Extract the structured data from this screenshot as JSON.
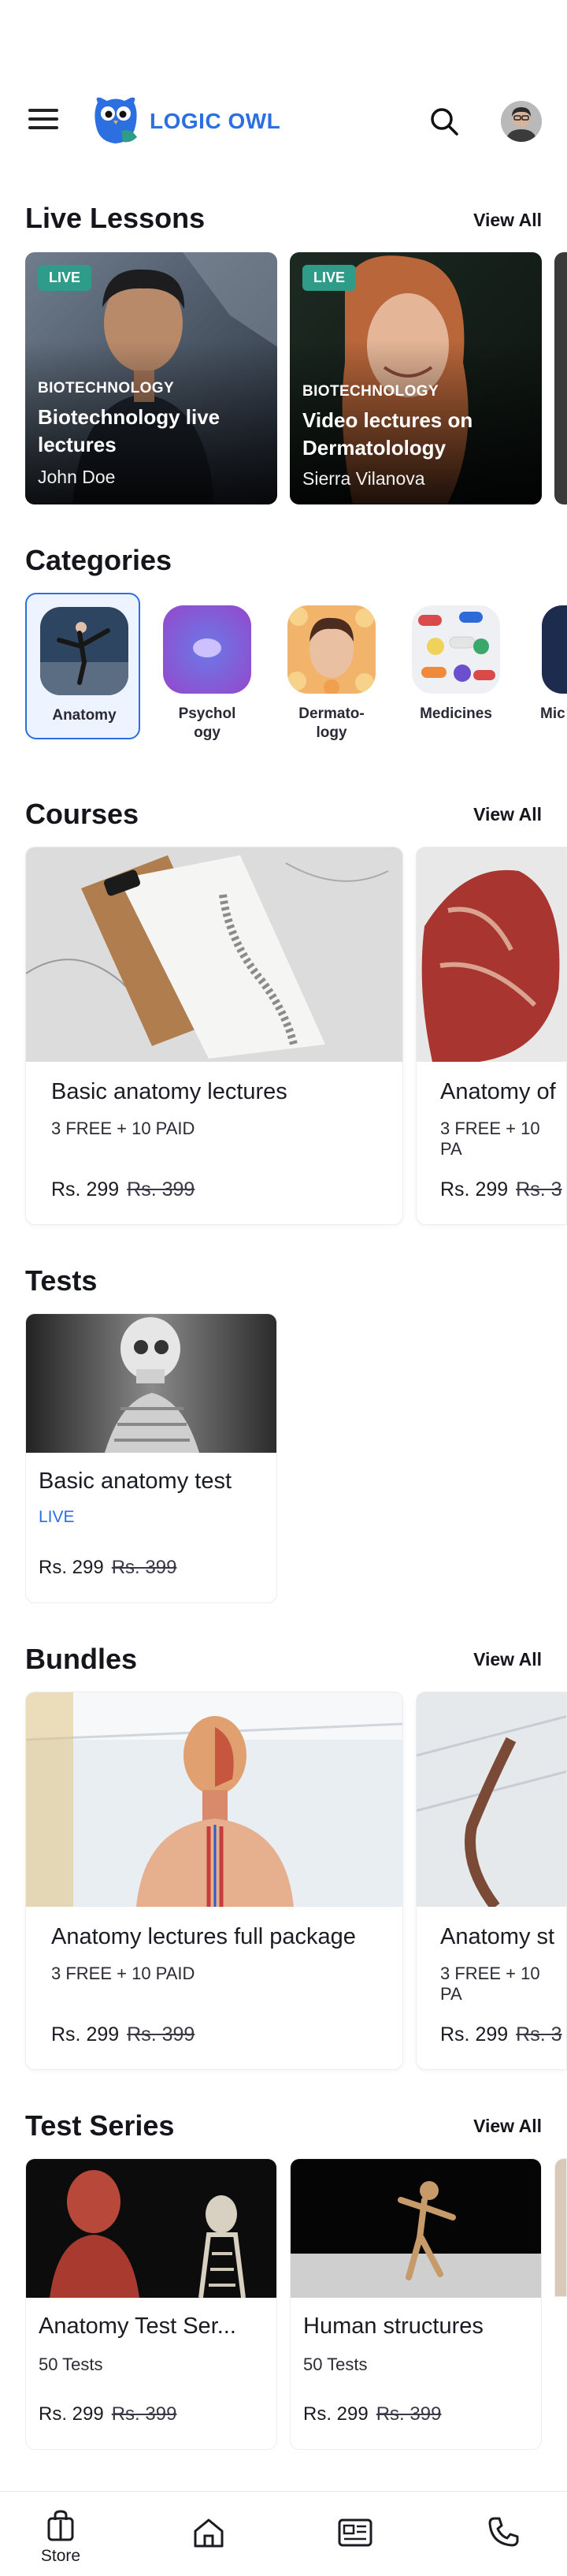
{
  "header": {
    "brand": "LOGIC OWL",
    "brand_color": "#2b6fe0",
    "menu_icon": "hamburger-menu-icon",
    "search_icon": "search-icon"
  },
  "live_lessons": {
    "title": "Live Lessons",
    "view_all": "View All",
    "items": [
      {
        "badge": "LIVE",
        "category": "BIOTECHNOLOGY",
        "title": "Biotechnology live lectures",
        "author": "John Doe"
      },
      {
        "badge": "LIVE",
        "category": "BIOTECHNOLOGY",
        "title": "Video lectures on Dermatolology",
        "author": "Sierra Vilanova"
      }
    ]
  },
  "categories": {
    "title": "Categories",
    "items": [
      {
        "label": "Anatomy"
      },
      {
        "label": "Psychol\nogy"
      },
      {
        "label": "Dermato-\nlogy"
      },
      {
        "label": "Medicines"
      },
      {
        "label": "Mic"
      }
    ]
  },
  "courses": {
    "title": "Courses",
    "view_all": "View All",
    "items": [
      {
        "title": "Basic anatomy lectures",
        "meta": "3 FREE + 10 PAID",
        "price": "Rs. 299",
        "old_price": "Rs. 399"
      },
      {
        "title": "Anatomy of",
        "meta": "3 FREE + 10 PA",
        "price": "Rs. 299",
        "old_price": "Rs. 3"
      }
    ]
  },
  "tests": {
    "title": "Tests",
    "items": [
      {
        "title": "Basic anatomy test",
        "status": "LIVE",
        "price": "Rs. 299",
        "old_price": "Rs. 399"
      }
    ]
  },
  "bundles": {
    "title": "Bundles",
    "view_all": "View All",
    "items": [
      {
        "title": "Anatomy lectures full package",
        "meta": "3 FREE + 10 PAID",
        "price": "Rs. 299",
        "old_price": "Rs. 399"
      },
      {
        "title": "Anatomy st",
        "meta": "3 FREE + 10 PA",
        "price": "Rs. 299",
        "old_price": "Rs. 3"
      }
    ]
  },
  "test_series": {
    "title": "Test Series",
    "view_all": "View All",
    "items": [
      {
        "title": "Anatomy Test Ser...",
        "meta": "50 Tests",
        "price": "Rs. 299",
        "old_price": "Rs. 399"
      },
      {
        "title": "Human structures",
        "meta": "50 Tests",
        "price": "Rs. 299",
        "old_price": "Rs. 399"
      }
    ]
  },
  "bottom_nav": {
    "items": [
      {
        "label": "Store",
        "icon": "store-bag-icon"
      },
      {
        "label": "",
        "icon": "home-icon"
      },
      {
        "label": "",
        "icon": "news-icon"
      },
      {
        "label": "",
        "icon": "phone-icon"
      }
    ]
  }
}
